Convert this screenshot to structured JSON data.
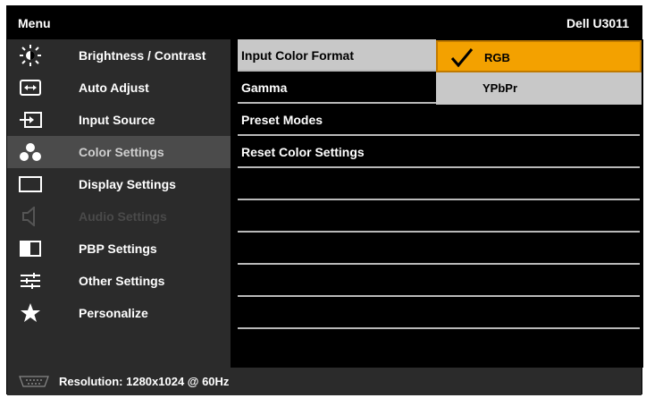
{
  "header": {
    "menu": "Menu",
    "model": "Dell U3011"
  },
  "sidebar": {
    "items": [
      {
        "label": "Brightness / Contrast",
        "icon": "brightness-icon"
      },
      {
        "label": "Auto Adjust",
        "icon": "auto-adjust-icon"
      },
      {
        "label": "Input Source",
        "icon": "input-source-icon"
      },
      {
        "label": "Color Settings",
        "icon": "color-settings-icon",
        "selected": true
      },
      {
        "label": "Display Settings",
        "icon": "display-settings-icon"
      },
      {
        "label": "Audio Settings",
        "icon": "speaker-icon",
        "disabled": true
      },
      {
        "label": "PBP Settings",
        "icon": "pbp-icon"
      },
      {
        "label": "Other Settings",
        "icon": "sliders-icon"
      },
      {
        "label": "Personalize",
        "icon": "star-icon"
      }
    ]
  },
  "content": {
    "rows": [
      {
        "label": "Input Color Format",
        "highlight": true
      },
      {
        "label": "Gamma"
      },
      {
        "label": "Preset Modes"
      },
      {
        "label": "Reset Color Settings"
      },
      {
        "label": ""
      },
      {
        "label": ""
      },
      {
        "label": ""
      },
      {
        "label": ""
      },
      {
        "label": ""
      }
    ],
    "options": [
      {
        "label": "RGB",
        "selected": true
      },
      {
        "label": "YPbPr",
        "selected": false
      }
    ]
  },
  "footer": {
    "resolution": "Resolution: 1280x1024 @ 60Hz",
    "input_icon": "vga-icon"
  },
  "colors": {
    "accent": "#f3a100",
    "sidebar": "#2b2b2b",
    "selected_bg": "#4b4b4b",
    "panel_bg": "#000000"
  }
}
